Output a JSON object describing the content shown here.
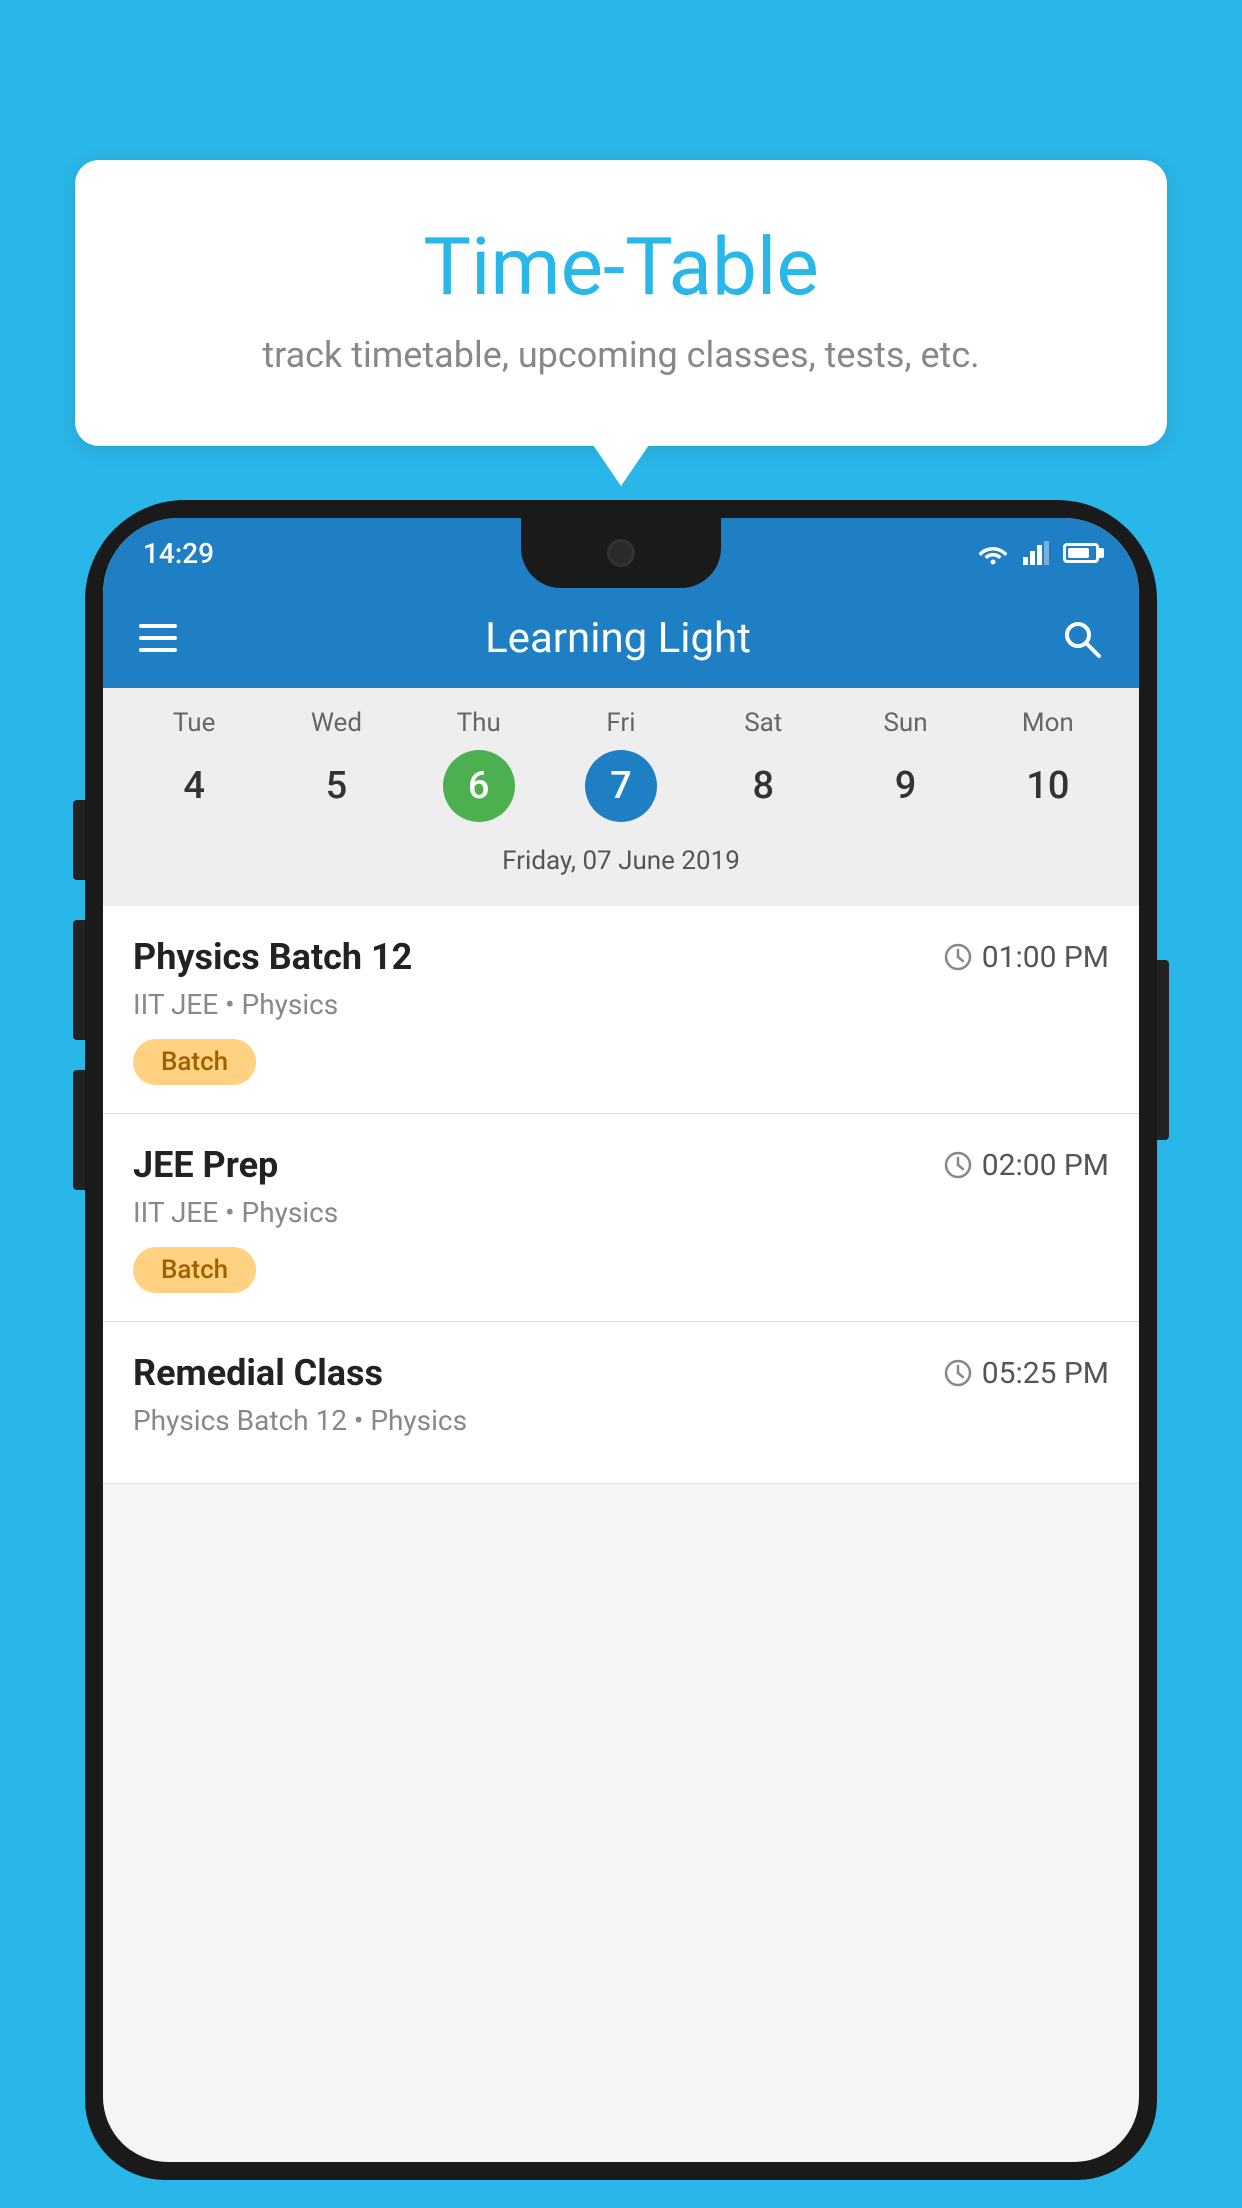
{
  "background_color": "#29b6e8",
  "tooltip": {
    "title": "Time-Table",
    "subtitle": "track timetable, upcoming classes, tests, etc."
  },
  "phone": {
    "status_bar": {
      "time": "14:29"
    },
    "app_bar": {
      "title": "Learning Light"
    },
    "calendar": {
      "days": [
        {
          "label": "Tue",
          "number": "4",
          "state": "normal"
        },
        {
          "label": "Wed",
          "number": "5",
          "state": "normal"
        },
        {
          "label": "Thu",
          "number": "6",
          "state": "today"
        },
        {
          "label": "Fri",
          "number": "7",
          "state": "selected"
        },
        {
          "label": "Sat",
          "number": "8",
          "state": "normal"
        },
        {
          "label": "Sun",
          "number": "9",
          "state": "normal"
        },
        {
          "label": "Mon",
          "number": "10",
          "state": "normal"
        }
      ],
      "selected_date_label": "Friday, 07 June 2019"
    },
    "schedule": [
      {
        "name": "Physics Batch 12",
        "time": "01:00 PM",
        "meta": "IIT JEE • Physics",
        "badge": "Batch"
      },
      {
        "name": "JEE Prep",
        "time": "02:00 PM",
        "meta": "IIT JEE • Physics",
        "badge": "Batch"
      },
      {
        "name": "Remedial Class",
        "time": "05:25 PM",
        "meta": "Physics Batch 12 • Physics",
        "badge": null
      }
    ]
  }
}
